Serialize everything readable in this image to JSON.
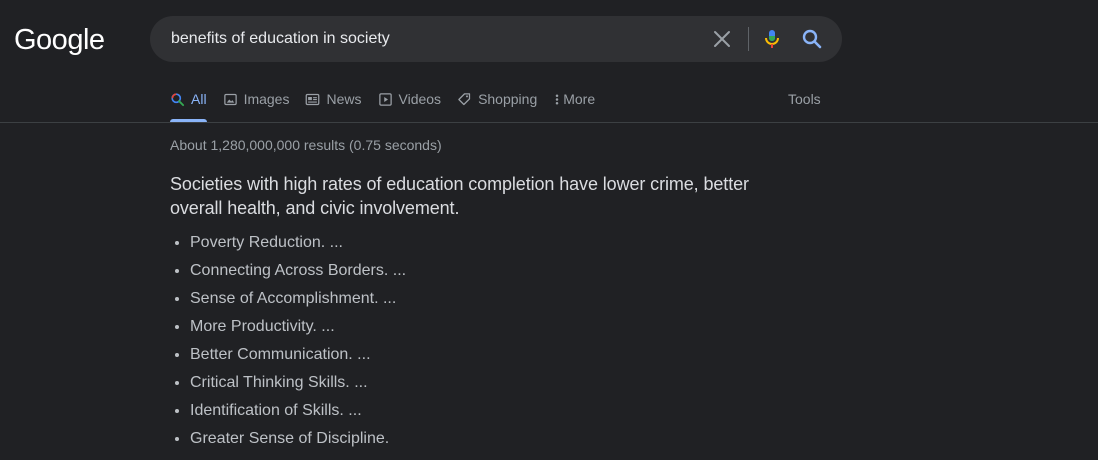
{
  "header": {
    "logo_text": "Google",
    "search_query": "benefits of education in society"
  },
  "tabs": [
    {
      "label": "All",
      "icon": "search-icon",
      "active": true
    },
    {
      "label": "Images",
      "icon": "image-icon",
      "active": false
    },
    {
      "label": "News",
      "icon": "news-icon",
      "active": false
    },
    {
      "label": "Videos",
      "icon": "video-icon",
      "active": false
    },
    {
      "label": "Shopping",
      "icon": "tag-icon",
      "active": false
    },
    {
      "label": "More",
      "icon": "more-vert-icon",
      "active": false
    }
  ],
  "tools_label": "Tools",
  "results": {
    "stats": "About 1,280,000,000 results (0.75 seconds)",
    "featured_snippet": {
      "heading": "Societies with high rates of education completion have lower crime, better overall health, and civic involvement.",
      "items": [
        "Poverty Reduction. ...",
        "Connecting Across Borders. ...",
        "Sense of Accomplishment. ...",
        "More Productivity. ...",
        "Better Communication. ...",
        "Critical Thinking Skills. ...",
        "Identification of Skills. ...",
        "Greater Sense of Discipline."
      ]
    }
  },
  "colors": {
    "background": "#202124",
    "search_box": "#303134",
    "accent": "#8ab4f8",
    "muted_text": "#9aa0a6",
    "body_text": "#bdc1c6"
  }
}
